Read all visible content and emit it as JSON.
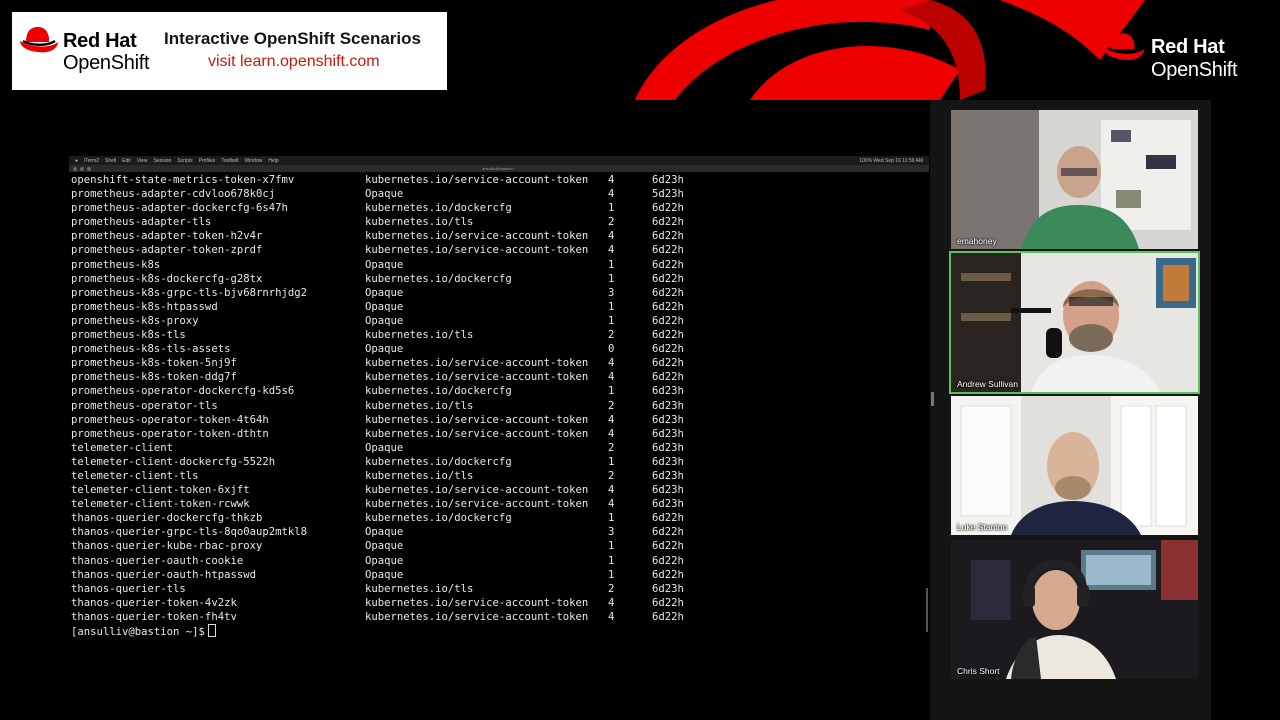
{
  "banner": {
    "brand_line1": "Red Hat",
    "brand_line2": "OpenShift",
    "title": "Interactive OpenShift Scenarios",
    "subtitle": "visit learn.openshift.com"
  },
  "logo_right": {
    "line1": "Red Hat",
    "line2": "OpenShift"
  },
  "terminal": {
    "menubar": [
      "iTerm2",
      "Shell",
      "Edit",
      "View",
      "Session",
      "Scripts",
      "Profiles",
      "Toolbelt",
      "Window",
      "Help"
    ],
    "status": "100%  Wed Sep 16 11:59 AM",
    "window_title": "ansulliv@bastion:~",
    "rows": [
      [
        "openshift-state-metrics-token-x7fmv",
        "kubernetes.io/service-account-token",
        "4",
        "6d23h"
      ],
      [
        "prometheus-adapter-cdvloo678k0cj",
        "Opaque",
        "4",
        "5d23h"
      ],
      [
        "prometheus-adapter-dockercfg-6s47h",
        "kubernetes.io/dockercfg",
        "1",
        "6d22h"
      ],
      [
        "prometheus-adapter-tls",
        "kubernetes.io/tls",
        "2",
        "6d22h"
      ],
      [
        "prometheus-adapter-token-h2v4r",
        "kubernetes.io/service-account-token",
        "4",
        "6d22h"
      ],
      [
        "prometheus-adapter-token-zprdf",
        "kubernetes.io/service-account-token",
        "4",
        "6d22h"
      ],
      [
        "prometheus-k8s",
        "Opaque",
        "1",
        "6d22h"
      ],
      [
        "prometheus-k8s-dockercfg-g28tx",
        "kubernetes.io/dockercfg",
        "1",
        "6d22h"
      ],
      [
        "prometheus-k8s-grpc-tls-bjv68rnrhjdg2",
        "Opaque",
        "3",
        "6d22h"
      ],
      [
        "prometheus-k8s-htpasswd",
        "Opaque",
        "1",
        "6d22h"
      ],
      [
        "prometheus-k8s-proxy",
        "Opaque",
        "1",
        "6d22h"
      ],
      [
        "prometheus-k8s-tls",
        "kubernetes.io/tls",
        "2",
        "6d22h"
      ],
      [
        "prometheus-k8s-tls-assets",
        "Opaque",
        "0",
        "6d22h"
      ],
      [
        "prometheus-k8s-token-5nj9f",
        "kubernetes.io/service-account-token",
        "4",
        "6d22h"
      ],
      [
        "prometheus-k8s-token-ddg7f",
        "kubernetes.io/service-account-token",
        "4",
        "6d22h"
      ],
      [
        "prometheus-operator-dockercfg-kd5s6",
        "kubernetes.io/dockercfg",
        "1",
        "6d23h"
      ],
      [
        "prometheus-operator-tls",
        "kubernetes.io/tls",
        "2",
        "6d23h"
      ],
      [
        "prometheus-operator-token-4t64h",
        "kubernetes.io/service-account-token",
        "4",
        "6d23h"
      ],
      [
        "prometheus-operator-token-dthtn",
        "kubernetes.io/service-account-token",
        "4",
        "6d23h"
      ],
      [
        "telemeter-client",
        "Opaque",
        "2",
        "6d23h"
      ],
      [
        "telemeter-client-dockercfg-5522h",
        "kubernetes.io/dockercfg",
        "1",
        "6d23h"
      ],
      [
        "telemeter-client-tls",
        "kubernetes.io/tls",
        "2",
        "6d23h"
      ],
      [
        "telemeter-client-token-6xjft",
        "kubernetes.io/service-account-token",
        "4",
        "6d23h"
      ],
      [
        "telemeter-client-token-rcwwk",
        "kubernetes.io/service-account-token",
        "4",
        "6d23h"
      ],
      [
        "thanos-querier-dockercfg-thkzb",
        "kubernetes.io/dockercfg",
        "1",
        "6d22h"
      ],
      [
        "thanos-querier-grpc-tls-8qo0aup2mtkl8",
        "Opaque",
        "3",
        "6d22h"
      ],
      [
        "thanos-querier-kube-rbac-proxy",
        "Opaque",
        "1",
        "6d22h"
      ],
      [
        "thanos-querier-oauth-cookie",
        "Opaque",
        "1",
        "6d22h"
      ],
      [
        "thanos-querier-oauth-htpasswd",
        "Opaque",
        "1",
        "6d22h"
      ],
      [
        "thanos-querier-tls",
        "kubernetes.io/tls",
        "2",
        "6d23h"
      ],
      [
        "thanos-querier-token-4v2zk",
        "kubernetes.io/service-account-token",
        "4",
        "6d22h"
      ],
      [
        "thanos-querier-token-fh4tv",
        "kubernetes.io/service-account-token",
        "4",
        "6d22h"
      ]
    ],
    "prompt": "[ansulliv@bastion ~]$"
  },
  "participants": [
    {
      "name": "emahoney",
      "active": false
    },
    {
      "name": "Andrew Sullivan",
      "active": true
    },
    {
      "name": "Luke Stanton",
      "active": false
    },
    {
      "name": "Chris Short",
      "active": false
    }
  ],
  "colors": {
    "brand_red": "#ee0000",
    "active_speaker": "#5cc35c"
  }
}
